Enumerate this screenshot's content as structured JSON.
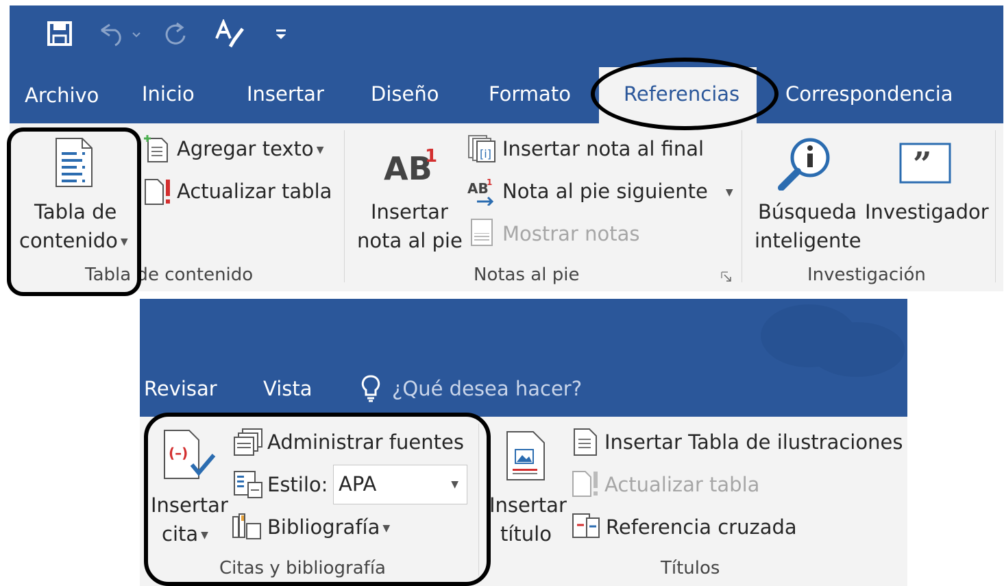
{
  "qat": {
    "icons": [
      "save-icon",
      "undo-icon",
      "redo-icon",
      "spelling-icon",
      "customize-qat-icon"
    ]
  },
  "tabs1": [
    "Archivo",
    "Inicio",
    "Insertar",
    "Diseño",
    "Formato",
    "Referencias",
    "Correspondencia"
  ],
  "tabs2": [
    "Revisar",
    "Vista"
  ],
  "tell_me": "¿Qué desea hacer?",
  "groups": {
    "toc": {
      "label": "Tabla de contenido",
      "toc_button": [
        "Tabla de",
        "contenido"
      ],
      "add_text": "Agregar texto",
      "update_table": "Actualizar tabla"
    },
    "footnotes": {
      "label": "Notas al pie",
      "insert_footnote": [
        "Insertar",
        "nota al pie"
      ],
      "insert_endnote": "Insertar nota al final",
      "next_footnote": "Nota al pie siguiente",
      "show_notes": "Mostrar notas"
    },
    "research": {
      "label": "Investigación",
      "smart_lookup": [
        "Búsqueda",
        "inteligente"
      ],
      "researcher": "Investigador"
    },
    "citations": {
      "label": "Citas y bibliografía",
      "insert_citation": [
        "Insertar",
        "cita"
      ],
      "manage_sources": "Administrar fuentes",
      "style_label": "Estilo:",
      "style_value": "APA",
      "bibliography": "Bibliografía"
    },
    "captions": {
      "label": "Títulos",
      "insert_caption": [
        "Insertar",
        "título"
      ],
      "insert_tof": "Insertar Tabla de ilustraciones",
      "update_table": "Actualizar tabla",
      "cross_reference": "Referencia cruzada"
    }
  },
  "colors": {
    "ribbon_blue": "#2b579a",
    "ribbon_bg": "#f3f3f3",
    "highlight": "#000000"
  }
}
